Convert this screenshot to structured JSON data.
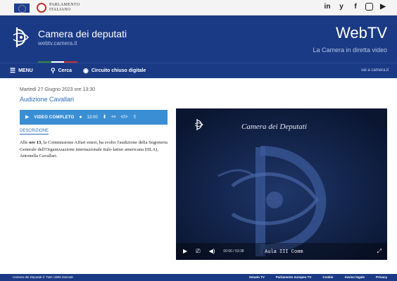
{
  "topbar": {
    "parliament_line1": "PARLAMENTO",
    "parliament_line2": "ITALIANO",
    "social_icons": [
      "linkedin-icon",
      "twitter-icon",
      "facebook-icon",
      "instagram-icon",
      "youtube-icon"
    ],
    "social_glyphs": [
      "in",
      "y",
      "f",
      "",
      "▶"
    ]
  },
  "header": {
    "site_title": "Camera dei deputati",
    "site_subtitle": "webtv.camera.it",
    "brand": "WebTV",
    "brand_tagline": "La Camera in diretta video",
    "colors": {
      "primary": "#1a3a85",
      "accent": "#3a8fd4",
      "tricolor": [
        "#2e8b3a",
        "#ffffff",
        "#c8302c"
      ]
    }
  },
  "nav": {
    "menu_label": "MENU",
    "search_label": "Cerca",
    "ccd_label": "Circuito chiuso digitale",
    "right_link": "vai a camera.it"
  },
  "event": {
    "date": "Martedì 27 Giugno 2023 ore 13:30",
    "title": "Audizione Cavallari",
    "video_label": "VIDEO COMPLETO",
    "duration": "13:00",
    "desc_tab": "DESCRIZIONE",
    "desc_pre": "Alle ",
    "desc_bold": "ore 13",
    "desc_post": ", la Commissione Affari esteri, ha svolto l'audizione della Segreteria Generale dell'Organizzazione internazionale italo-latino americana (IILA), Antonella Cavallari."
  },
  "player": {
    "caption": "Camera dei Deputati",
    "time": "00:00 / 53:38",
    "room": "Aula III Comm"
  },
  "footer": {
    "copyright": "Camera dei Deputati © Tutti i diritti riservati",
    "links": [
      "Senato TV",
      "Parlamento europeo TV",
      "Cookie",
      "Avviso legale",
      "Privacy"
    ]
  }
}
